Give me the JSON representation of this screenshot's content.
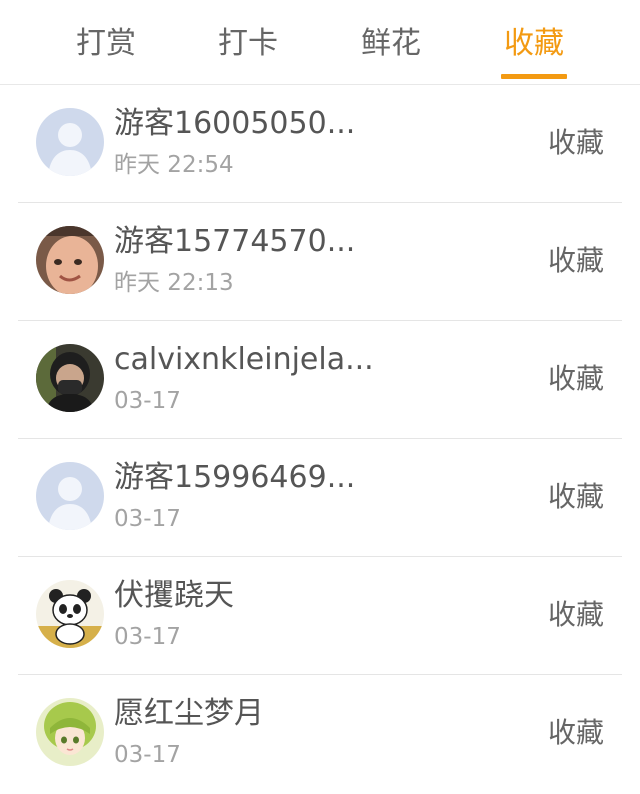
{
  "tabs": [
    {
      "label": "打赏"
    },
    {
      "label": "打卡"
    },
    {
      "label": "鲜花"
    },
    {
      "label": "收藏",
      "active": true
    }
  ],
  "colors": {
    "accent": "#f39a12",
    "text": "#555555",
    "subtext": "#a3a3a3"
  },
  "rows": [
    {
      "name": "游客16005050...",
      "time": "昨天 22:54",
      "action": "收藏",
      "avatar": "default-avatar-icon"
    },
    {
      "name": "游客15774570...",
      "time": "昨天 22:13",
      "action": "收藏",
      "avatar": "baby-photo-avatar"
    },
    {
      "name": "calvixnkleinjela...",
      "time": "03-17",
      "action": "收藏",
      "avatar": "masked-person-avatar"
    },
    {
      "name": "游客15996469...",
      "time": "03-17",
      "action": "收藏",
      "avatar": "default-avatar-icon"
    },
    {
      "name": "伏攫跷天",
      "time": "03-17",
      "action": "收藏",
      "avatar": "panda-cartoon-avatar"
    },
    {
      "name": "愿红尘梦月",
      "time": "03-17",
      "action": "收藏",
      "avatar": "anime-girl-avatar"
    }
  ]
}
